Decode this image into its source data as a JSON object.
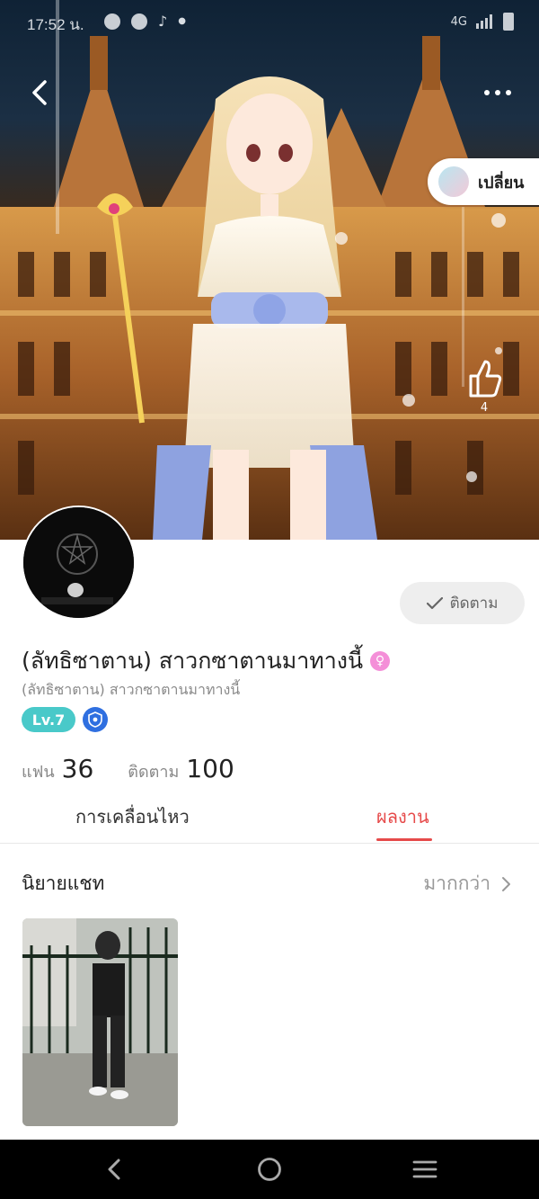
{
  "status_bar": {
    "time": "17:52 น.",
    "network": "4G"
  },
  "hero": {
    "change_label": "เปลี่ยน",
    "like_count": "4"
  },
  "profile": {
    "name": "(ลัทธิซาตาน) สาวกซาตานมาทางนี้",
    "subname": "(ลัทธิซาตาน) สาวกซาตานมาทางนี้",
    "gender_symbol": "♀",
    "level": "Lv.7",
    "follow_label": "ติดตาม",
    "stats": [
      {
        "label": "แฟน",
        "value": "36"
      },
      {
        "label": "ติดตาม",
        "value": "100"
      }
    ]
  },
  "tabs": [
    {
      "label": "การเคลื่อนไหว",
      "active": false
    },
    {
      "label": "ผลงาน",
      "active": true
    }
  ],
  "section": {
    "title": "นิยายแชท",
    "more_label": "มากกว่า"
  },
  "colors": {
    "accent_red": "#e64a4a",
    "level_teal": "#49c9c9",
    "shield_blue": "#2f6fe0",
    "gender_pink": "#f48fd8"
  }
}
